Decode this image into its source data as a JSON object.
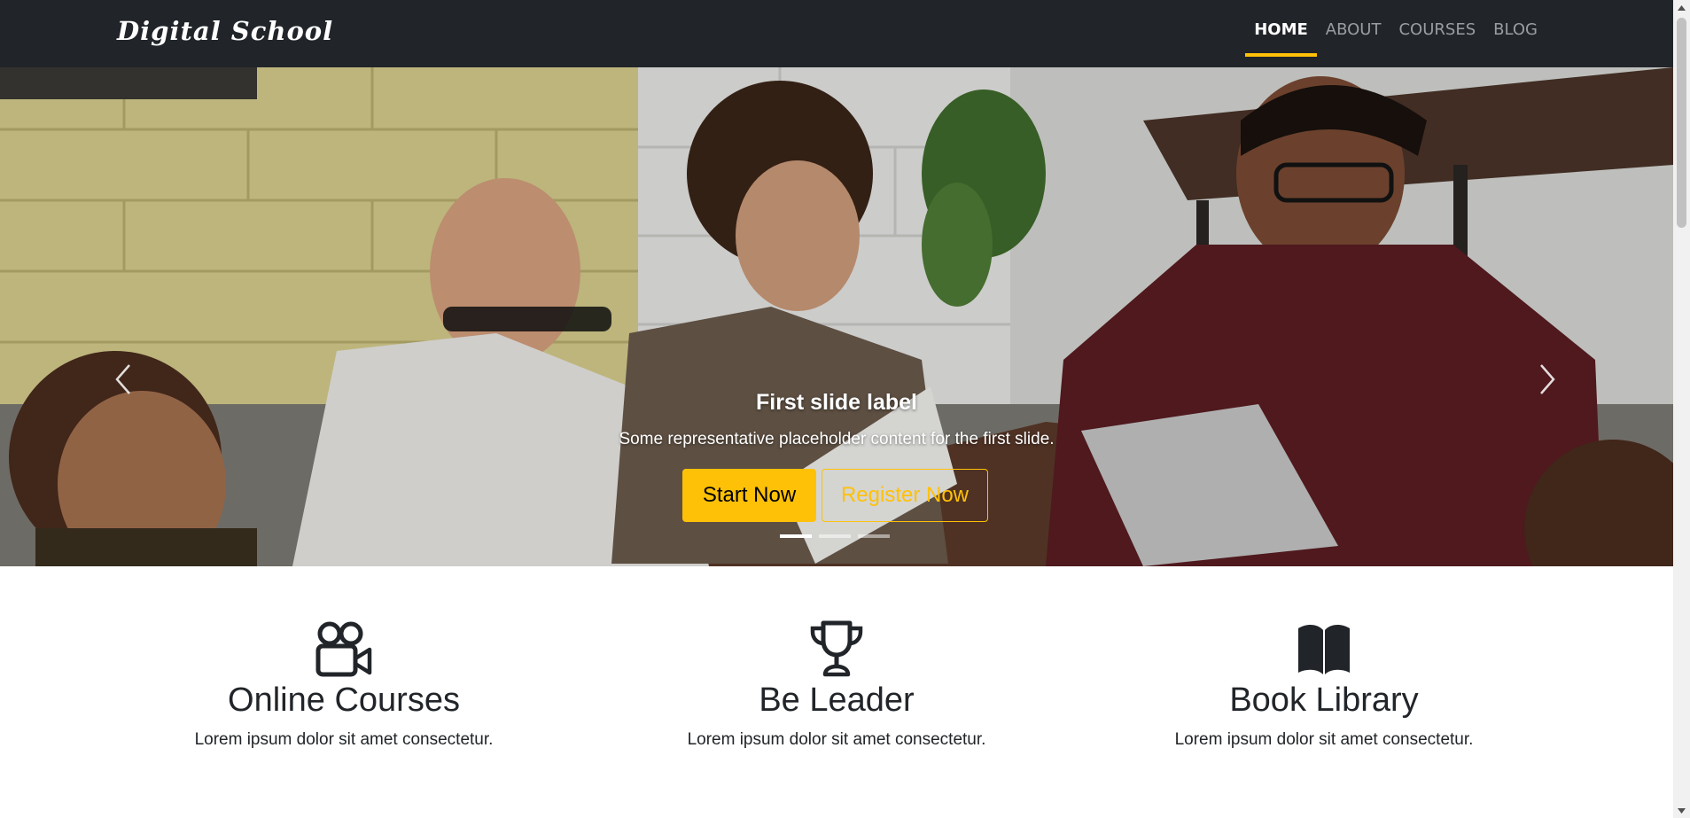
{
  "navbar": {
    "brand": "Digital School",
    "links": [
      {
        "label": "HOME",
        "active": true
      },
      {
        "label": "ABOUT",
        "active": false
      },
      {
        "label": "COURSES",
        "active": false
      },
      {
        "label": "BLOG",
        "active": false
      }
    ]
  },
  "hero": {
    "slide_title": "First slide label",
    "slide_text": "Some representative placeholder content for the first slide.",
    "primary_button": "Start Now",
    "secondary_button": "Register Now",
    "active_slide": 1,
    "slide_count": 3
  },
  "features": [
    {
      "icon": "video-camera-icon",
      "title": "Online Courses",
      "text": "Lorem ipsum dolor sit amet consectetur."
    },
    {
      "icon": "trophy-icon",
      "title": "Be Leader",
      "text": "Lorem ipsum dolor sit amet consectetur."
    },
    {
      "icon": "book-icon",
      "title": "Book Library",
      "text": "Lorem ipsum dolor sit amet consectetur."
    }
  ],
  "colors": {
    "navbar_bg": "#212529",
    "accent": "#ffc107",
    "text": "#212529"
  }
}
